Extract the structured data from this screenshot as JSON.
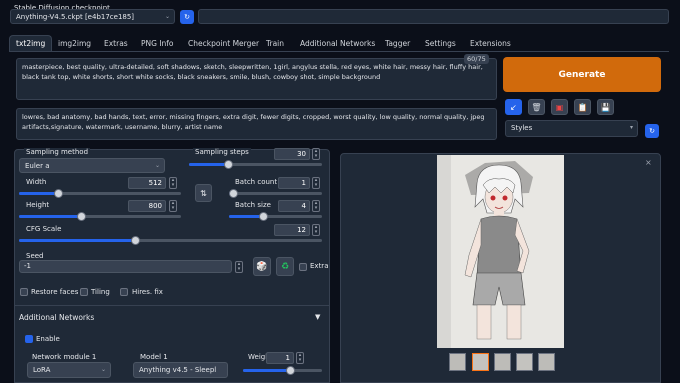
{
  "checkpoint": {
    "label": "Stable Diffusion checkpoint",
    "value": "Anything-V4.5.ckpt [e4b17ce185]"
  },
  "tabs": [
    "txt2img",
    "img2img",
    "Extras",
    "PNG Info",
    "Checkpoint Merger",
    "Train",
    "Additional Networks",
    "Tagger",
    "Settings",
    "Extensions"
  ],
  "prompt": {
    "text": "masterpiece, best quality, ultra-detailed, soft shadows, sketch, sleepwritten, 1girl, angylus stella, red eyes, white hair, messy hair, fluffy hair, black tank top, white shorts, short white socks, black sneakers, smile, blush, cowboy shot, simple background",
    "token_count": "60/75"
  },
  "negative_prompt": {
    "text": "lowres, bad anatomy, bad hands, text, error, missing fingers, extra digit, fewer digits, cropped, worst quality, low quality, normal quality, jpeg artifacts,signature, watermark, username, blurry, artist name"
  },
  "generate": {
    "label": "Generate",
    "color": "#d16a0c"
  },
  "styles": {
    "label": "Styles"
  },
  "sampling": {
    "method_label": "Sampling method",
    "method_value": "Euler a",
    "steps_label": "Sampling steps",
    "steps_value": "30"
  },
  "width": {
    "label": "Width",
    "value": "512"
  },
  "height": {
    "label": "Height",
    "value": "800"
  },
  "batch_count": {
    "label": "Batch count",
    "value": "1"
  },
  "batch_size": {
    "label": "Batch size",
    "value": "4"
  },
  "cfg": {
    "label": "CFG Scale",
    "value": "12"
  },
  "seed": {
    "label": "Seed",
    "value": "-1",
    "extra_label": "Extra"
  },
  "options": {
    "restore_faces": "Restore faces",
    "tiling": "Tiling",
    "hires_fix": "Hires. fix"
  },
  "additional_networks": {
    "title": "Additional Networks",
    "enable_label": "Enable",
    "module_label": "Network module 1",
    "module_value": "LoRA",
    "model_label": "Model 1",
    "model_value": "Anything v4.5 - Sleepl",
    "weight_label": "Weigh",
    "weight_value": "1"
  },
  "colors": {
    "accent": "#2563eb",
    "background": "#0b0f19",
    "panel": "#1f2937"
  }
}
